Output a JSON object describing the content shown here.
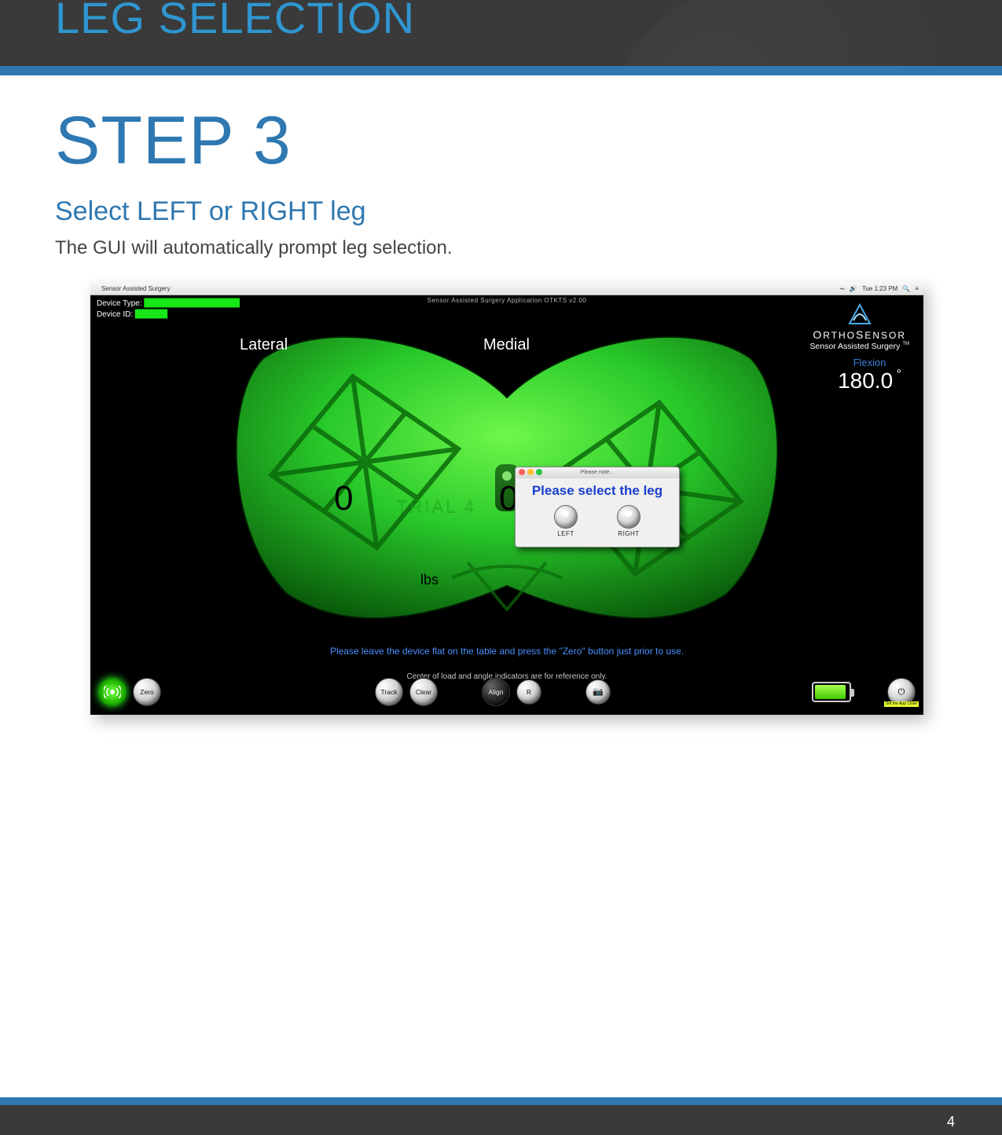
{
  "header": {
    "section_title": "LEG SELECTION"
  },
  "step": {
    "title": "STEP 3",
    "subtitle": "Select LEFT or RIGHT leg",
    "body": "The GUI will automatically prompt leg selection."
  },
  "mac_bar": {
    "app_name": "Sensor Assisted Surgery",
    "time": "Tue 1:23 PM"
  },
  "app": {
    "title_text": "Sensor Assisted Surgery Application OTKTS v2.00",
    "device_type_label": "Device Type:",
    "device_type_value": "████████████████████████",
    "device_id_label": "Device ID:",
    "device_id_value": "████████",
    "brand_top": "ORTHOSENSOR",
    "brand_sub": "Sensor Assisted Surgery",
    "brand_tm": "TM",
    "flexion_label": "Flexion",
    "flexion_value": "180.0",
    "lateral_label": "Lateral",
    "medial_label": "Medial",
    "left_value": "0",
    "right_value": "0",
    "trial_text": "TRIAL 4",
    "unit_label": "lbs",
    "instruction_primary": "Please leave the device flat on the table and press the \"Zero\" button just prior to use.",
    "instruction_secondary": "Center of load and angle indicators are for reference only."
  },
  "dialog": {
    "window_title": "Please note...",
    "message": "Please select the leg",
    "left_label": "LEFT",
    "right_label": "RIGHT"
  },
  "toolbar": {
    "zero": "Zero",
    "track": "Track",
    "clear": "Clear",
    "align": "Align",
    "r": "R",
    "power_hint": "Set the App Close"
  },
  "footer": {
    "page_number": "4"
  }
}
